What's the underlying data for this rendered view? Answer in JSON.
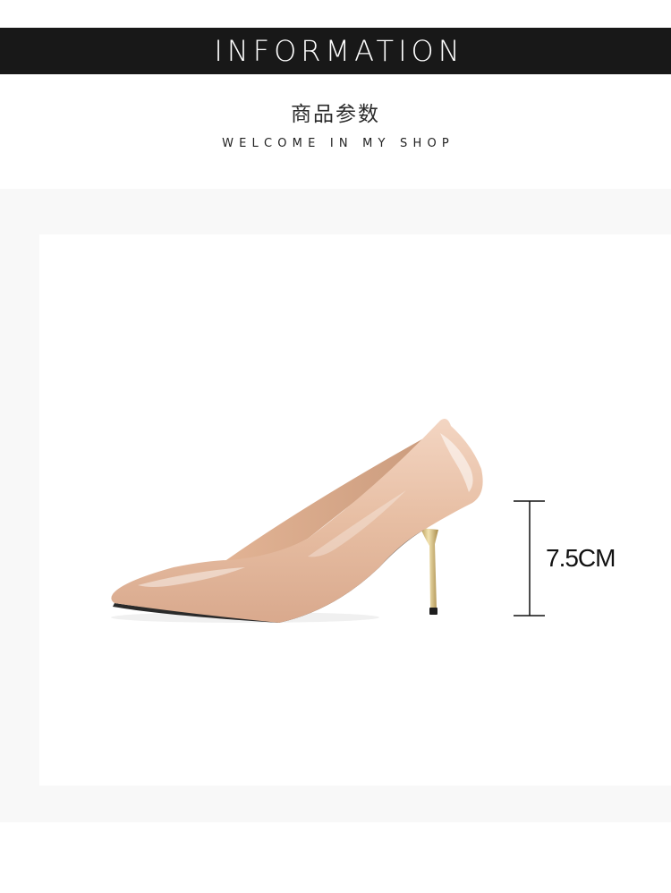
{
  "header": {
    "title": "INFORMATION",
    "subtitle_cn": "商品参数",
    "subtitle_en": "WELCOME IN MY SHOP"
  },
  "product": {
    "heel_height": "7.5CM",
    "image": "nude-patent-pointed-toe-pump-stiletto",
    "colors": {
      "leather": "#e9c3aa",
      "heel": "#d9c28a",
      "sole": "#2a2a2a"
    }
  },
  "colors": {
    "banner": "#181818",
    "band": "#f8f8f8",
    "card": "#ffffff"
  }
}
